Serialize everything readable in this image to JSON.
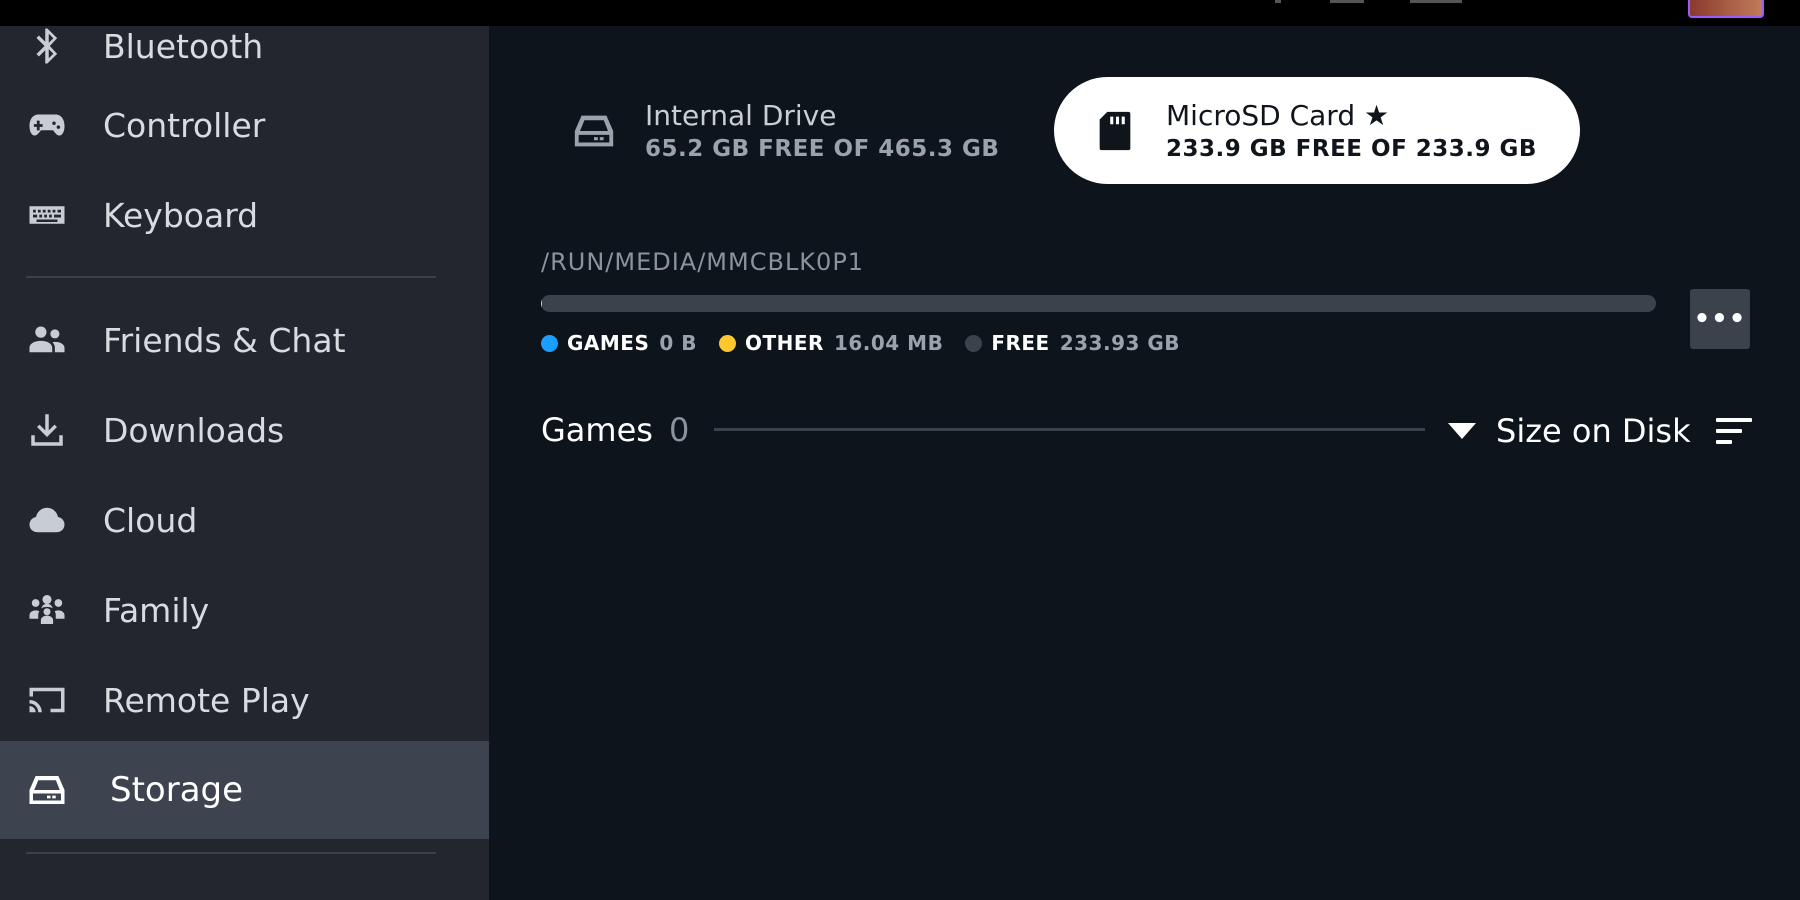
{
  "sidebar": {
    "items": [
      {
        "label": "Bluetooth",
        "icon": "bluetooth-icon"
      },
      {
        "label": "Controller",
        "icon": "controller-icon"
      },
      {
        "label": "Keyboard",
        "icon": "keyboard-icon"
      },
      {
        "label": "Friends & Chat",
        "icon": "friends-icon"
      },
      {
        "label": "Downloads",
        "icon": "download-icon"
      },
      {
        "label": "Cloud",
        "icon": "cloud-icon"
      },
      {
        "label": "Family",
        "icon": "family-icon"
      },
      {
        "label": "Remote Play",
        "icon": "cast-icon"
      },
      {
        "label": "Storage",
        "icon": "storage-icon",
        "active": true
      }
    ]
  },
  "drives": {
    "internal": {
      "name": "Internal Drive",
      "size": "65.2 GB FREE OF 465.3 GB",
      "icon": "hard-drive-icon"
    },
    "microsd": {
      "name": "MicroSD Card",
      "star": "★",
      "size": "233.9 GB FREE OF 233.9 GB",
      "icon": "sd-card-icon",
      "selected": true
    }
  },
  "storage": {
    "path": "/RUN/MEDIA/MMCBLK0P1",
    "more_label": "•••",
    "usage": {
      "games_fraction": 0.0,
      "other_fraction": 0.0001,
      "free_fraction": 0.9999
    },
    "legend": [
      {
        "name": "GAMES",
        "value": "0 B",
        "color": "#1a9fff"
      },
      {
        "name": "OTHER",
        "value": "16.04 MB",
        "color": "#ffc82c"
      },
      {
        "name": "FREE",
        "value": "233.93 GB",
        "color": "#3c424b"
      }
    ]
  },
  "games": {
    "title": "Games",
    "count": "0",
    "sort_label": "Size on Disk"
  },
  "colors": {
    "sidebar_bg": "#23262e",
    "sidebar_active": "#3d4450",
    "main_bg": "#0e141b",
    "bar_bg": "#3c424b",
    "games_blue": "#1a9fff",
    "other_yellow": "#ffc82c"
  }
}
